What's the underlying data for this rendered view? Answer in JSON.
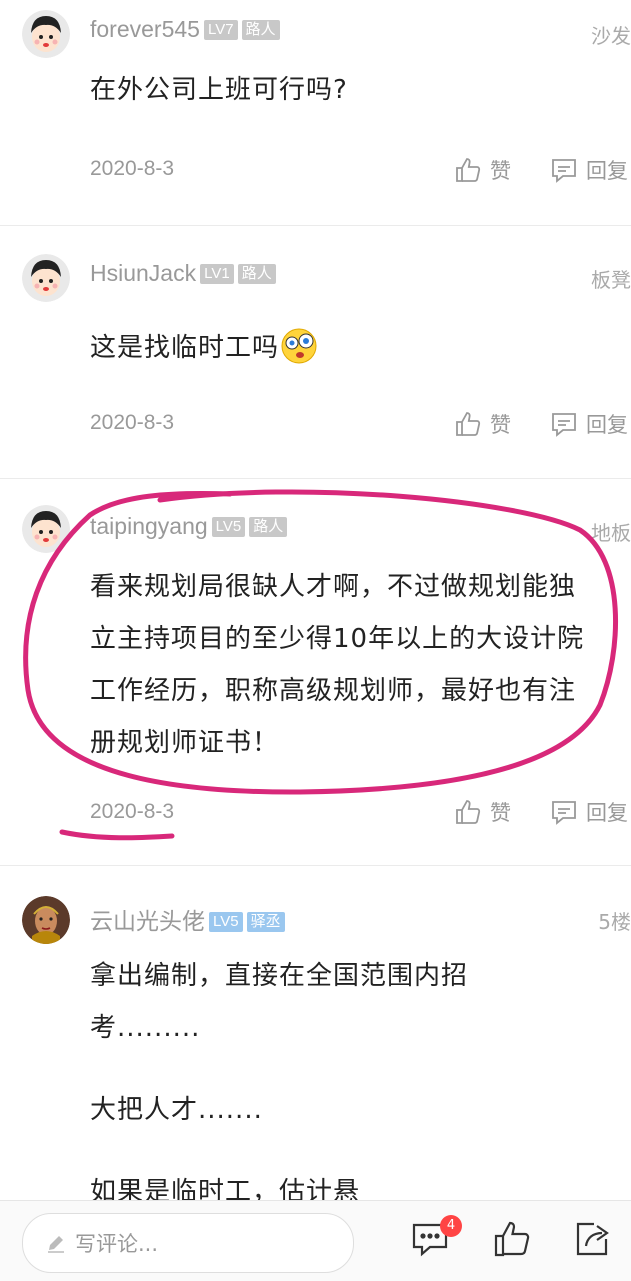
{
  "comments": [
    {
      "username": "forever545",
      "level": "LV7",
      "badge": "路人",
      "floor": "沙发",
      "text": "在外公司上班可行吗?",
      "date": "2020-8-3",
      "like_label": "赞",
      "reply_label": "回复"
    },
    {
      "username": "HsiunJack",
      "level": "LV1",
      "badge": "路人",
      "floor": "板凳",
      "text": "这是找临时工吗",
      "emoji": "surprised-face-emoji",
      "date": "2020-8-3",
      "like_label": "赞",
      "reply_label": "回复"
    },
    {
      "username": "taipingyang",
      "level": "LV5",
      "badge": "路人",
      "floor": "地板",
      "text": "看来规划局很缺人才啊，不过做规划能独立主持项目的至少得10年以上的大设计院工作经历，职称高级规划师，最好也有注册规划师证书！",
      "date": "2020-8-3",
      "like_label": "赞",
      "reply_label": "回复",
      "annotation_color": "#d8287a"
    },
    {
      "username": "云山光头佬",
      "level": "LV5",
      "badge": "驿丞",
      "floor": "5楼",
      "text_lines": [
        "拿出编制，直接在全国范围内招考.........",
        "大把人才.......",
        "如果是临时工，估计悬"
      ]
    }
  ],
  "bottom_bar": {
    "input_placeholder": "写评论...",
    "comment_count": "4",
    "icons": [
      "pencil-icon",
      "comment-icon",
      "thumbs-up-icon",
      "share-icon"
    ]
  },
  "colors": {
    "accent_pink": "#d8287a",
    "level_grey": "#c8c8c8",
    "level_blue": "#9ac7ef",
    "notification_red": "#ff4444"
  }
}
